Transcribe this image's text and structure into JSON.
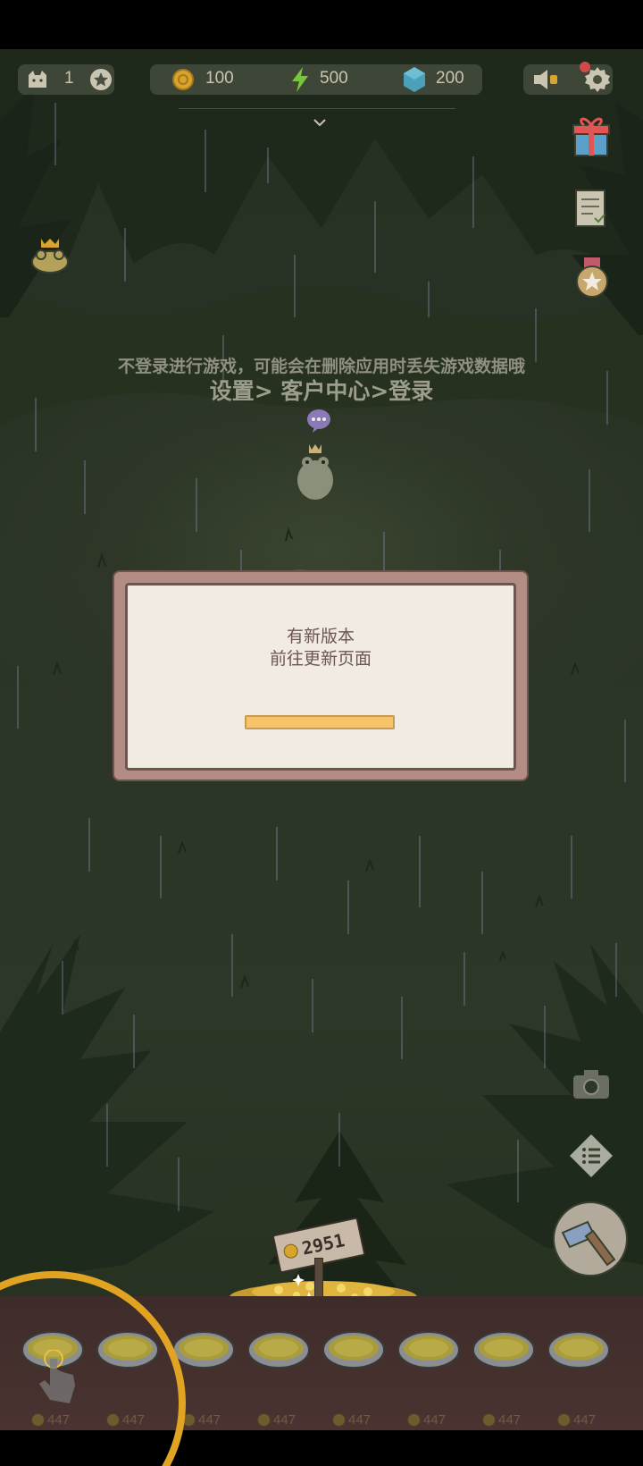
{
  "hud": {
    "cat_count": "1",
    "coins": "100",
    "energy": "500",
    "gems": "200"
  },
  "hint": {
    "line1": "不登录进行游戏，可能会在删除应用时丢失游戏数据哦",
    "line2": "设置> 客户中心>登录"
  },
  "dialog": {
    "line1": "有新版本",
    "line2": "前往更新页面"
  },
  "sign_value": "2951",
  "bowls": [
    {
      "price": "447"
    },
    {
      "price": "447"
    },
    {
      "price": "447"
    },
    {
      "price": "447"
    },
    {
      "price": "447"
    },
    {
      "price": "447"
    },
    {
      "price": "447"
    },
    {
      "price": "447"
    }
  ],
  "colors": {
    "dialog_frame": "#b38d84",
    "dialog_bg": "#f2ebe1",
    "dialog_text": "#6b5652",
    "progress_bar": "#f7c46a",
    "tutorial_ring": "#e0a322"
  },
  "icons": [
    "cat-icon",
    "star-badge-icon",
    "coin-icon",
    "lightning-icon",
    "gem-icon",
    "speaker-icon",
    "gear-icon",
    "gift-icon",
    "checklist-icon",
    "medal-icon",
    "frog-crown-icon",
    "camera-icon",
    "menu-list-icon",
    "hammer-icon",
    "pointer-hand-icon",
    "chevron-down-icon"
  ]
}
